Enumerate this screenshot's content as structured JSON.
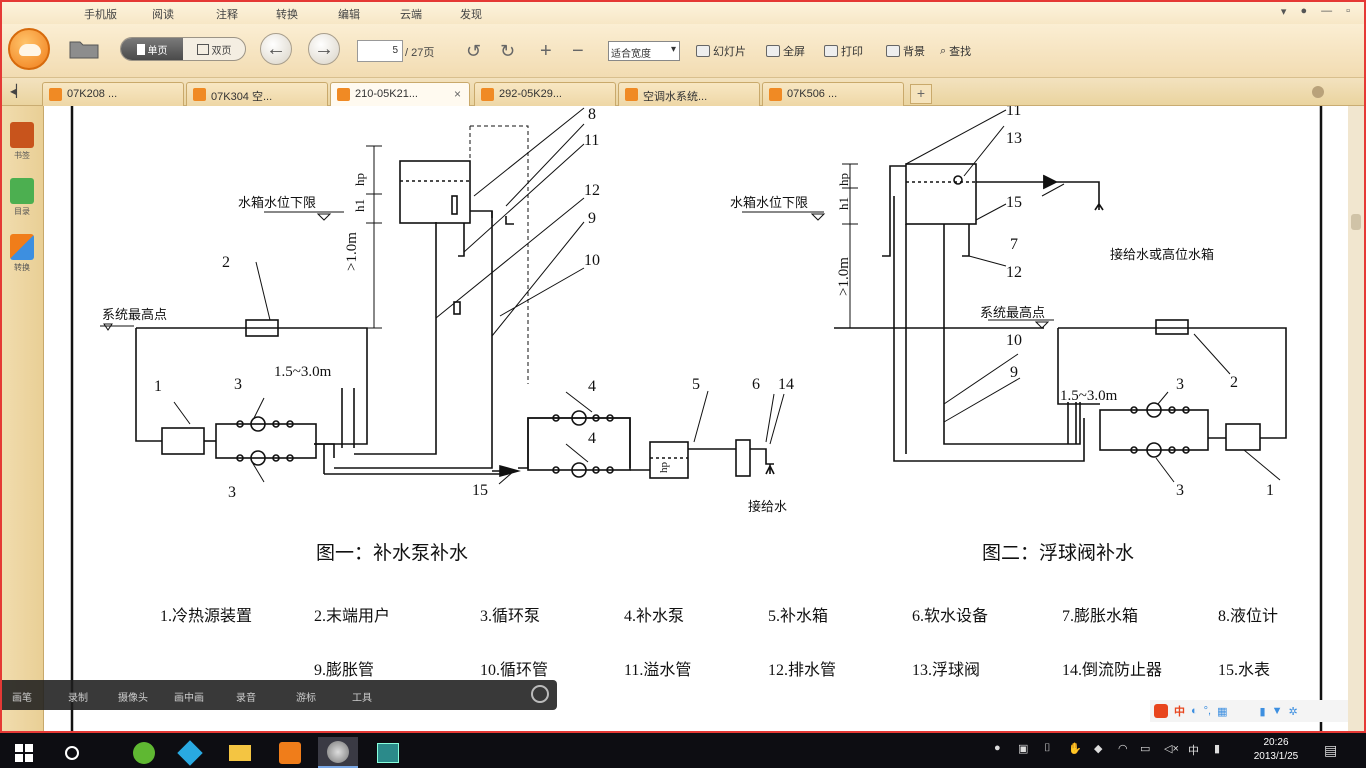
{
  "menu": {
    "items": [
      "手机版",
      "阅读",
      "注释",
      "转换",
      "编辑",
      "云端",
      "发现"
    ]
  },
  "window_controls": [
    "▾",
    "●",
    "—",
    "▫"
  ],
  "toolbar": {
    "view_single": "单页",
    "view_double": "双页",
    "page_current": "5",
    "page_total": "/ 27页",
    "zoom": "适合宽度",
    "slideshow": "幻灯片",
    "fullscreen": "全屏",
    "print": "打印",
    "background": "背景",
    "find": "查找"
  },
  "tabs": [
    {
      "label": "07K208 ...",
      "close": ""
    },
    {
      "label": "07K304 空...",
      "close": ""
    },
    {
      "label": "210-05K21...",
      "close": "×"
    },
    {
      "label": "292-05K29...",
      "close": ""
    },
    {
      "label": "空调水系统...",
      "close": ""
    },
    {
      "label": "07K506 ...",
      "close": ""
    }
  ],
  "sidebar": {
    "items": [
      {
        "label": "书签",
        "color": "#c8541c"
      },
      {
        "label": "目录",
        "color": "#4caf50"
      },
      {
        "label": "转换",
        "color": "#3d8fe0"
      }
    ]
  },
  "figure1": {
    "caption": "图一：补水泵补水",
    "water_level_label": "水箱水位下限",
    "highest_point_label": "系统最高点",
    "height_label": ">1.0m",
    "h1_label": "h1",
    "hp_label": "hp",
    "distance_label": "1.5~3.0m",
    "feed_label": "接给水",
    "numbers": [
      "1",
      "2",
      "3",
      "3",
      "4",
      "4",
      "5",
      "6",
      "8",
      "9",
      "10",
      "11",
      "12",
      "14",
      "15"
    ]
  },
  "figure2": {
    "caption": "图二：浮球阀补水",
    "water_level_label": "水箱水位下限",
    "highest_point_label": "系统最高点",
    "height_label": ">1.0m",
    "h1_label": "h1",
    "hp_label": "hp",
    "distance_label": "1.5~3.0m",
    "feed_label": "接给水或高位水箱",
    "numbers": [
      "1",
      "2",
      "3",
      "3",
      "7",
      "9",
      "10",
      "11",
      "12",
      "13",
      "15"
    ]
  },
  "legend": [
    "1.冷热源装置",
    "2.末端用户",
    "3.循环泵",
    "4.补水泵",
    "5.补水箱",
    "6.软水设备",
    "7.膨胀水箱",
    "8.液位计",
    "9.膨胀管",
    "10.循环管",
    "11.溢水管",
    "12.排水管",
    "13.浮球阀",
    "14.倒流防止器",
    "15.水表"
  ],
  "overlay_bar": {
    "items": [
      "画笔",
      "录制",
      "摄像头",
      "画中画",
      "录音",
      "游标",
      "工具"
    ]
  },
  "ime": {
    "mode": "中"
  },
  "clock": {
    "time": "20:26",
    "date": "2013/1/25"
  },
  "tray": {
    "language": "中"
  }
}
